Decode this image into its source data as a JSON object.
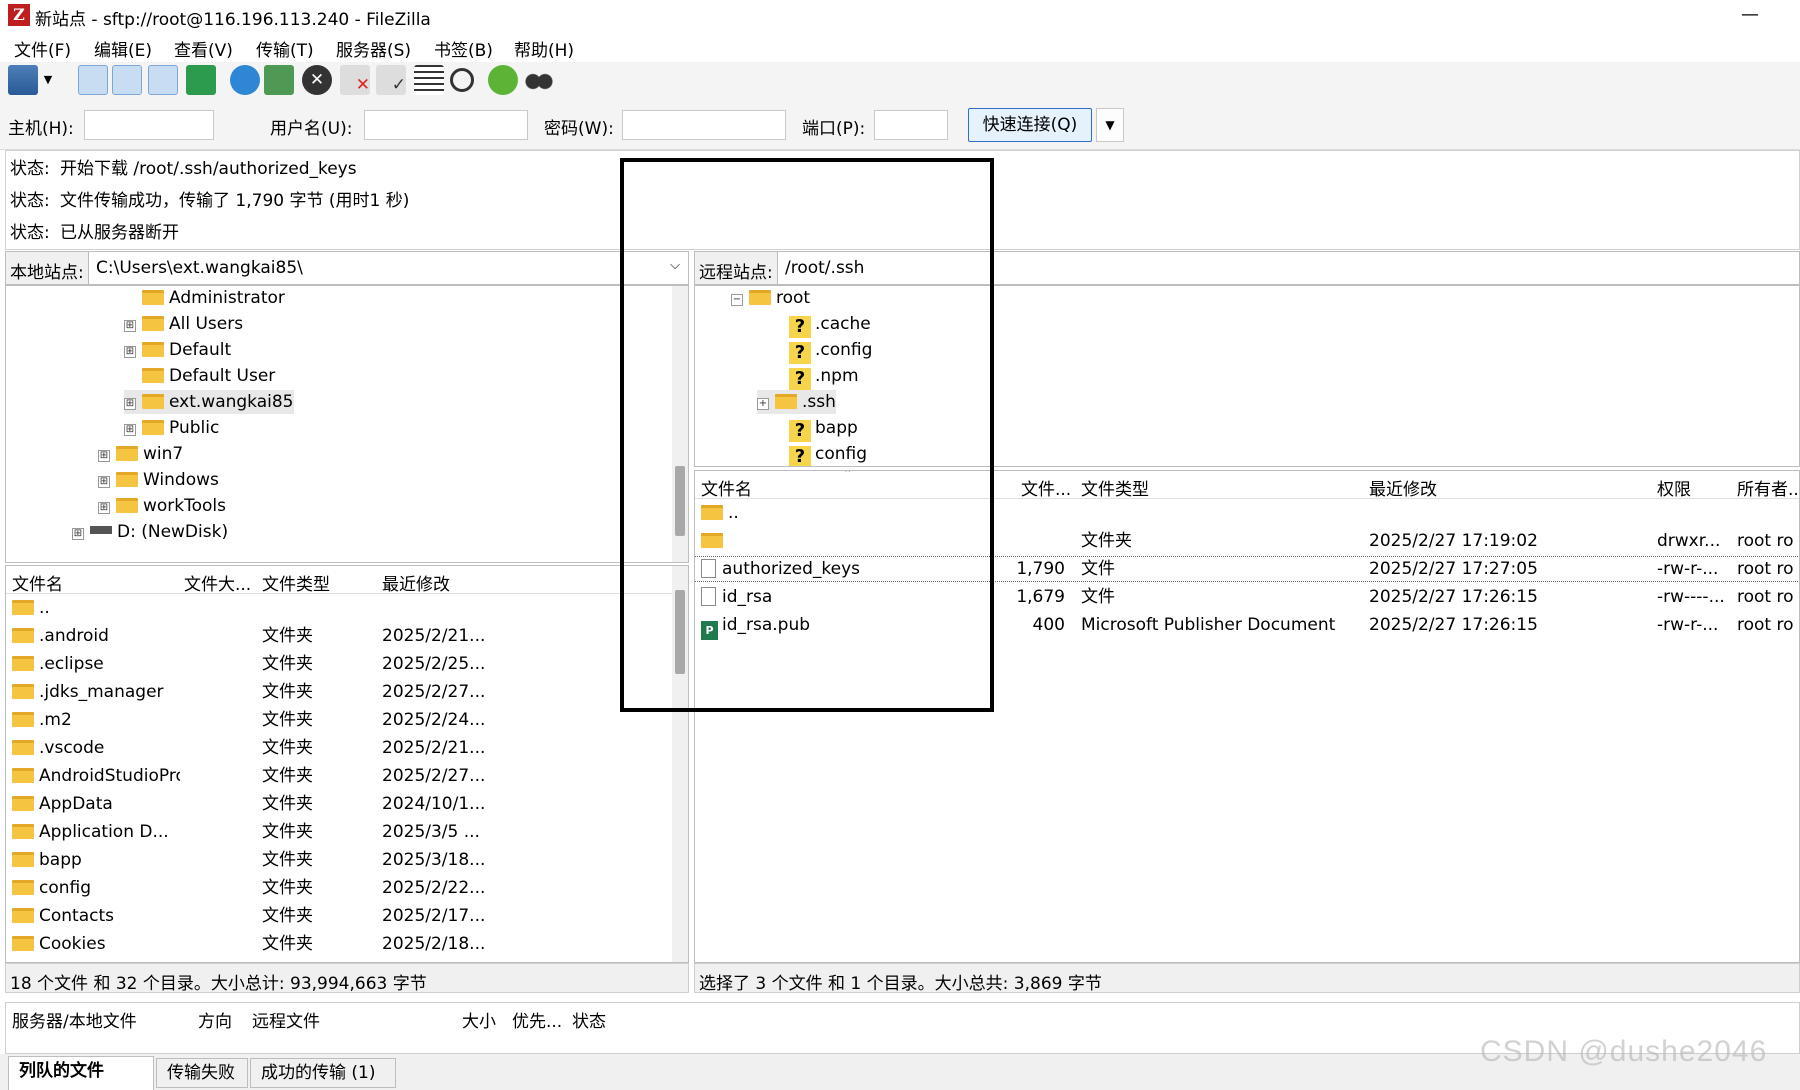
{
  "titlebar": {
    "app_icon_letter": "Z",
    "title": "新站点 - sftp://root@116.196.113.240 - FileZilla",
    "minimize": "—"
  },
  "menu": [
    "文件(F)",
    "编辑(E)",
    "查看(V)",
    "传输(T)",
    "服务器(S)",
    "书签(B)",
    "帮助(H)"
  ],
  "quickconnect": {
    "host_label": "主机(H):",
    "user_label": "用户名(U):",
    "password_label": "密码(W):",
    "port_label": "端口(P):",
    "host_value": "",
    "user_value": "",
    "password_value": "",
    "port_value": "",
    "connect_button": "快速连接(Q)",
    "dropdown_icon": "▼"
  },
  "log": [
    {
      "label": "状态:",
      "text": "开始下载 /root/.ssh/authorized_keys"
    },
    {
      "label": "状态:",
      "text": "文件传输成功，传输了 1,790 字节 (用时1 秒)"
    },
    {
      "label": "状态:",
      "text": "已从服务器断开"
    }
  ],
  "local": {
    "site_label": "本地站点:",
    "path": "C:\\Users\\ext.wangkai85\\",
    "tree": [
      {
        "name": "Administrator",
        "expander": ""
      },
      {
        "name": "All Users",
        "expander": "⊞"
      },
      {
        "name": "Default",
        "expander": "⊞"
      },
      {
        "name": "Default User",
        "expander": ""
      },
      {
        "name": "ext.wangkai85",
        "expander": "⊞"
      },
      {
        "name": "Public",
        "expander": "⊞"
      },
      {
        "name": "win7",
        "expander": "⊞"
      },
      {
        "name": "Windows",
        "expander": "⊞"
      },
      {
        "name": "workTools",
        "expander": "⊞"
      },
      {
        "name": "D: (NewDisk)",
        "expander": "⊞"
      }
    ],
    "columns": [
      "文件名",
      "文件大...",
      "文件类型",
      "最近修改"
    ],
    "files": [
      {
        "name": "..",
        "type": "",
        "modified": ""
      },
      {
        "name": ".android",
        "type": "文件夹",
        "modified": "2025/2/21..."
      },
      {
        "name": ".eclipse",
        "type": "文件夹",
        "modified": "2025/2/25..."
      },
      {
        "name": ".jdks_manager",
        "type": "文件夹",
        "modified": "2025/2/27..."
      },
      {
        "name": ".m2",
        "type": "文件夹",
        "modified": "2025/2/24..."
      },
      {
        "name": ".vscode",
        "type": "文件夹",
        "modified": "2025/2/21..."
      },
      {
        "name": "AndroidStudioProjects",
        "type": "文件夹",
        "modified": "2025/2/27..."
      },
      {
        "name": "AppData",
        "type": "文件夹",
        "modified": "2024/10/1..."
      },
      {
        "name": "Application D...",
        "type": "文件夹",
        "modified": "2025/3/5 ..."
      },
      {
        "name": "bapp",
        "type": "文件夹",
        "modified": "2025/3/18..."
      },
      {
        "name": "config",
        "type": "文件夹",
        "modified": "2025/2/22..."
      },
      {
        "name": "Contacts",
        "type": "文件夹",
        "modified": "2025/2/17..."
      },
      {
        "name": "Cookies",
        "type": "文件夹",
        "modified": "2025/2/18..."
      }
    ],
    "status": "18 个文件 和 32 个目录。大小总计: 93,994,663 字节"
  },
  "remote": {
    "site_label": "远程站点:",
    "path": "/root/.ssh",
    "tree_root": "root",
    "tree": [
      {
        "name": ".cache",
        "kind": "unknown"
      },
      {
        "name": ".config",
        "kind": "unknown"
      },
      {
        "name": ".npm",
        "kind": "unknown"
      },
      {
        "name": ".ssh",
        "kind": "folder"
      },
      {
        "name": "bapp",
        "kind": "unknown"
      },
      {
        "name": "config",
        "kind": "unknown"
      }
    ],
    "columns": [
      "文件名",
      "文件...",
      "文件类型",
      "最近修改",
      "权限",
      "所有者..."
    ],
    "files": [
      {
        "name": "..",
        "size": "",
        "type": "",
        "modified": "",
        "perm": "",
        "owner": "",
        "icon": "folder"
      },
      {
        "name": "",
        "size": "",
        "type": "文件夹",
        "modified": "2025/2/27 17:19:02",
        "perm": "drwxr...",
        "owner": "root ro",
        "icon": "folder"
      },
      {
        "name": "authorized_keys",
        "size": "1,790",
        "type": "文件",
        "modified": "2025/2/27 17:27:05",
        "perm": "-rw-r-...",
        "owner": "root ro",
        "icon": "file"
      },
      {
        "name": "id_rsa",
        "size": "1,679",
        "type": "文件",
        "modified": "2025/2/27 17:26:15",
        "perm": "-rw----...",
        "owner": "root ro",
        "icon": "file"
      },
      {
        "name": "id_rsa.pub",
        "size": "400",
        "type": "Microsoft Publisher Document",
        "modified": "2025/2/27 17:26:15",
        "perm": "-rw-r-...",
        "owner": "root ro",
        "icon": "publisher"
      }
    ],
    "status": "选择了 3 个文件 和 1 个目录。大小总共: 3,869 字节"
  },
  "queue": {
    "columns": [
      "服务器/本地文件",
      "方向",
      "远程文件",
      "大小",
      "优先...",
      "状态"
    ]
  },
  "tabs": [
    "列队的文件",
    "传输失败",
    "成功的传输 (1)"
  ],
  "watermark": "CSDN @dushe2046",
  "colors": {
    "accent": "#2f6fc9",
    "folder": "#f5c542",
    "title_icon": "#bf1e1e"
  }
}
